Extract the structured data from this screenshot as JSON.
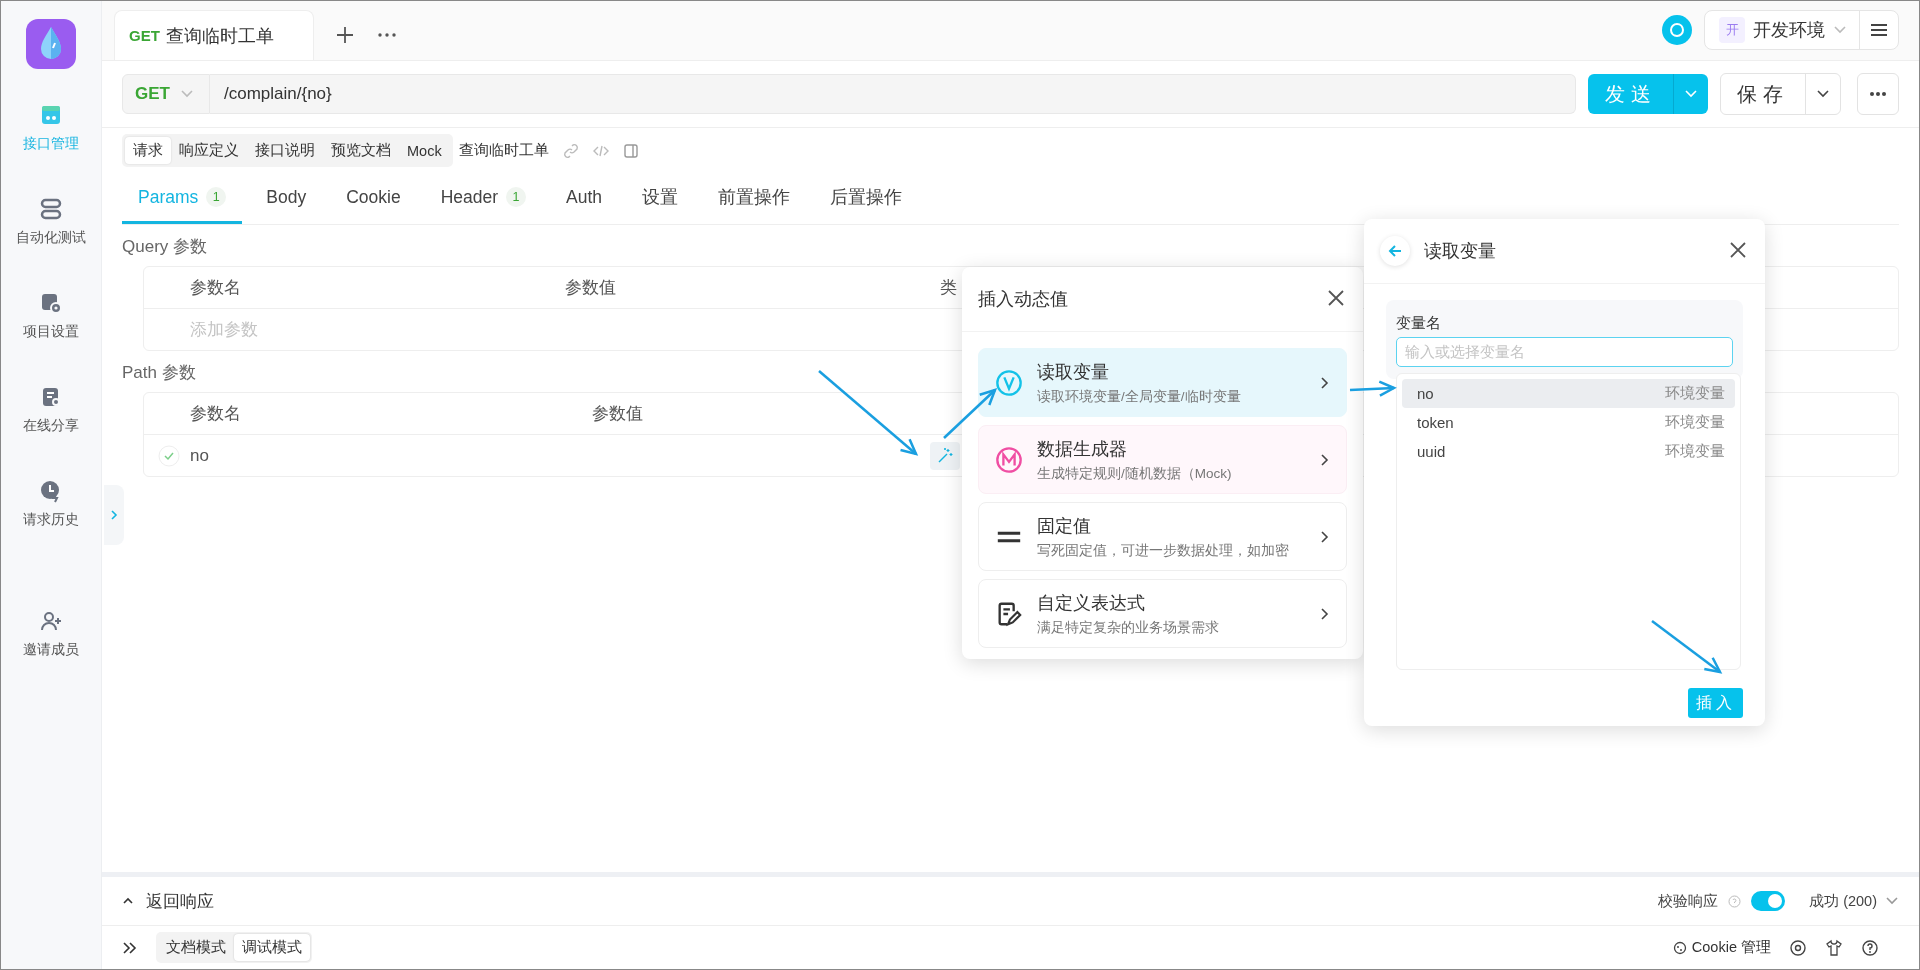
{
  "sidebar": {
    "items": [
      {
        "label": "接口管理",
        "selected": true
      },
      {
        "label": "自动化测试",
        "selected": false
      },
      {
        "label": "项目设置",
        "selected": false
      },
      {
        "label": "在线分享",
        "selected": false
      },
      {
        "label": "请求历史",
        "selected": false
      },
      {
        "label": "邀请成员",
        "selected": false
      }
    ]
  },
  "tabs": [
    {
      "method": "GET",
      "title": "查询临时工单",
      "selected": true
    }
  ],
  "environment": {
    "badge": "开",
    "name": "开发环境"
  },
  "request": {
    "method": "GET",
    "url": "/complain/{no}",
    "send": "发送",
    "save": "保存"
  },
  "sub_tabs": [
    {
      "label": "请求",
      "selected": true
    },
    {
      "label": "响应定义",
      "selected": false
    },
    {
      "label": "接口说明",
      "selected": false
    },
    {
      "label": "预览文档",
      "selected": false
    },
    {
      "label": "Mock",
      "selected": false
    }
  ],
  "api_name": "查询临时工单",
  "param_tabs": [
    {
      "label": "Params",
      "count": "1",
      "selected": true
    },
    {
      "label": "Body",
      "selected": false
    },
    {
      "label": "Cookie",
      "selected": false
    },
    {
      "label": "Header",
      "count": "1",
      "selected": false
    },
    {
      "label": "Auth",
      "selected": false
    },
    {
      "label": "设置",
      "selected": false
    },
    {
      "label": "前置操作",
      "selected": false
    },
    {
      "label": "后置操作",
      "selected": false
    }
  ],
  "query": {
    "title": "Query 参数",
    "columns": [
      "参数名",
      "参数值",
      "类"
    ],
    "placeholder": "添加参数"
  },
  "path": {
    "title": "Path 参数",
    "columns": [
      "参数名",
      "参数值"
    ],
    "rows": [
      {
        "name": "no",
        "checked": true
      }
    ]
  },
  "insert_popover": {
    "title": "插入动态值",
    "options": [
      {
        "kind": "variable",
        "title": "读取变量",
        "desc": "读取环境变量/全局变量/临时变量",
        "selected": true
      },
      {
        "kind": "mock",
        "title": "数据生成器",
        "desc": "生成特定规则/随机数据（Mock)",
        "selected": false
      },
      {
        "kind": "fixed",
        "title": "固定值",
        "desc": "写死固定值，可进一步数据处理，如加密",
        "selected": false
      },
      {
        "kind": "expression",
        "title": "自定义表达式",
        "desc": "满足特定复杂的业务场景需求",
        "selected": false
      }
    ]
  },
  "variable_panel": {
    "title": "读取变量",
    "field_label": "变量名",
    "placeholder": "输入或选择变量名",
    "options": [
      {
        "name": "no",
        "scope": "环境变量",
        "selected": true
      },
      {
        "name": "token",
        "scope": "环境变量",
        "selected": false
      },
      {
        "name": "uuid",
        "scope": "环境变量",
        "selected": false
      }
    ],
    "insert": "插入"
  },
  "response": {
    "title": "返回响应",
    "validate_label": "校验响应",
    "validate_on": true,
    "status": "成功 (200)"
  },
  "footer": {
    "modes": [
      {
        "label": "文档模式",
        "selected": false
      },
      {
        "label": "调试模式",
        "selected": true
      }
    ],
    "cookie": "Cookie 管理"
  }
}
